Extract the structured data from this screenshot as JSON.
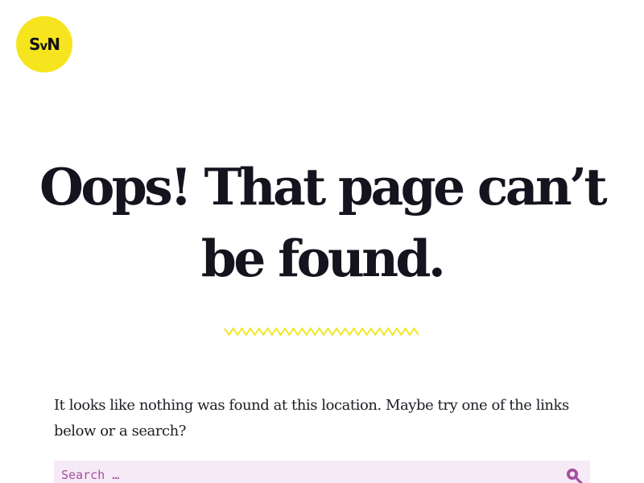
{
  "logo": {
    "text_main": "SvN",
    "color": "#f6e51e"
  },
  "heading": {
    "title": "Oops! That page can’t be found."
  },
  "divider": {
    "icon": "squiggle-line",
    "color": "#f0e620"
  },
  "content": {
    "intro": "It looks like nothing was found at this location. Maybe try one of the links below or a search?"
  },
  "search": {
    "placeholder": "Search …",
    "value": "",
    "icon": "search-icon",
    "accent_color": "#a5509e",
    "field_color": "#f6eaf6"
  }
}
